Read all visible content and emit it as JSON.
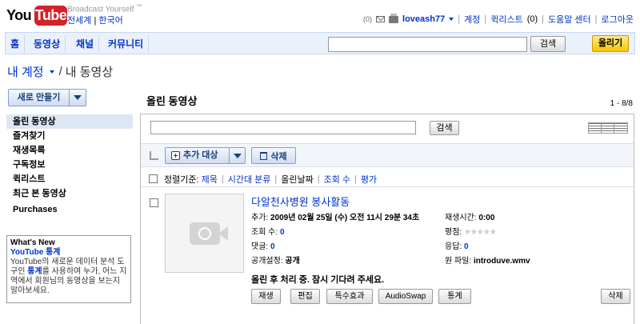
{
  "header": {
    "logo_you": "You",
    "logo_tube": "Tube",
    "tagline": "Broadcast Yourself",
    "tagline_tm": "™",
    "lang_global": "전세계",
    "lang_sep": "|",
    "lang_korea": "한국어"
  },
  "userbar": {
    "mail_count": "(0)",
    "print_count": "(0)",
    "username": "loveash77",
    "account": "계정",
    "quicklist": "퀵리스트",
    "quicklist_count": "(0)",
    "help": "도움말 센터",
    "logout": "로그아웃"
  },
  "nav": {
    "tabs": [
      "홈",
      "동영상",
      "채널",
      "커뮤니티"
    ],
    "search_button": "검색",
    "upload_button": "올리기"
  },
  "breadcrumb": {
    "account": "내 계정",
    "slash": "/",
    "current": "내 동영상"
  },
  "sidebar": {
    "new_button": "새로 만들기",
    "items": [
      "올린 동영상",
      "즐겨찾기",
      "재생목록",
      "구독정보",
      "퀵리스트",
      "최근 본 동영상",
      "Purchases"
    ]
  },
  "whatsnew": {
    "heading": "What's New",
    "link": "YouTube 통계",
    "text_1": "YouTube의 새로운 데이터 분석 도구인 ",
    "text_link": "통계",
    "text_2": "를 사용하여 누가, 어느 지역에서 회원님의 동영상을 보는지 알아보세요."
  },
  "main": {
    "title": "올린 동영상",
    "count": "1 - 8/8",
    "filter_button": "검색",
    "add_to": "추가 대상",
    "delete": "삭제",
    "sort": {
      "label": "정렬기준:",
      "options": [
        "제목",
        "시간대 분류",
        "올린날짜",
        "조회 수",
        "평가"
      ],
      "active_index": 2
    }
  },
  "video": {
    "title": "다알천사병원 봉사활동",
    "added_label": "추가:",
    "added_value": "2009년 02월 25일 (수) 오전 11시 29분 34초",
    "duration_label": "재생시간:",
    "duration_value": "0:00",
    "views_label": "조회 수:",
    "views_value": "0",
    "rating_label": "평점:",
    "rating_stars": 0,
    "comments_label": "댓글:",
    "comments_value": "0",
    "responses_label": "응답:",
    "responses_value": "0",
    "privacy_label": "공개설정:",
    "privacy_value": "공개",
    "file_label": "원 파일:",
    "file_value": "introduve.wmv",
    "processing": "올린 후 처리 중. 잠시 기다려 주세요.",
    "buttons": [
      "재생",
      "편집",
      "특수효과",
      "AudioSwap",
      "통계"
    ],
    "delete_button": "삭제"
  }
}
